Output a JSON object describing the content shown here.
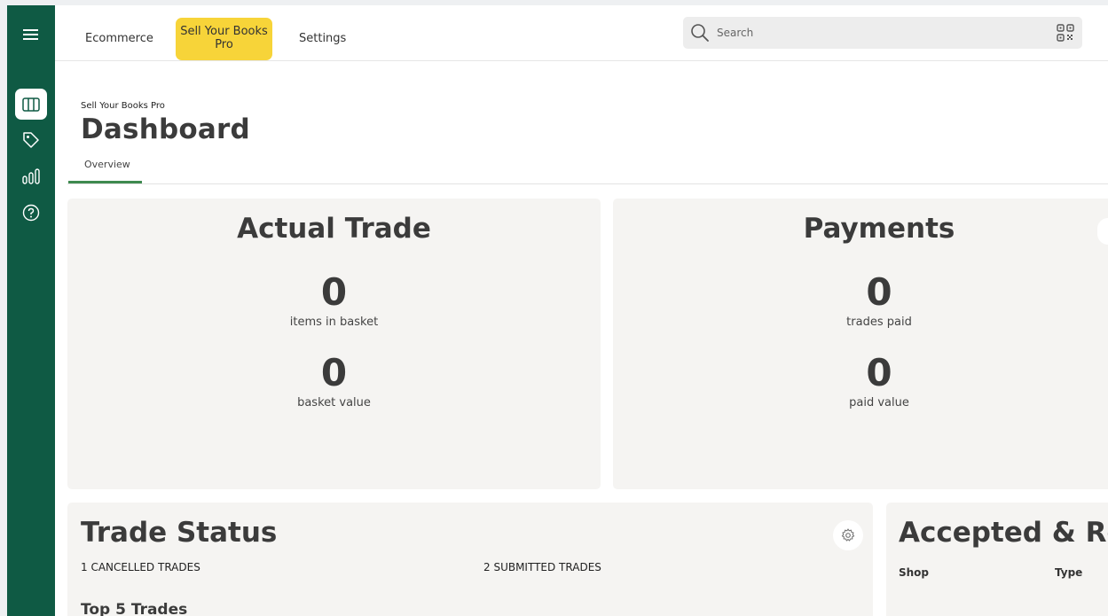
{
  "nav": {
    "tabs": [
      {
        "label": "Ecommerce"
      },
      {
        "label": "Sell Your Books Pro",
        "active": true
      },
      {
        "label": "Settings"
      }
    ]
  },
  "search": {
    "placeholder": "Search"
  },
  "rail": {
    "icons": [
      "menu-icon",
      "columns-icon",
      "tag-icon",
      "bar-chart-icon",
      "help-icon"
    ],
    "color": "#0f5a44"
  },
  "header": {
    "breadcrumb": "Sell Your Books Pro",
    "title": "Dashboard",
    "subtab": "Overview"
  },
  "actual_trade": {
    "title": "Actual Trade",
    "stats": [
      {
        "value": "0",
        "label": "items in basket"
      },
      {
        "value": "0",
        "label": "basket value"
      }
    ]
  },
  "payments": {
    "title": "Payments",
    "stats": [
      {
        "value": "0",
        "label": "trades paid"
      },
      {
        "value": "0",
        "label": "paid value"
      }
    ]
  },
  "trade_status": {
    "title": "Trade Status",
    "cancelled": "1 CANCELLED TRADES",
    "submitted": "2 SUBMITTED TRADES",
    "top5": "Top 5 Trades"
  },
  "accepted": {
    "title": "Accepted & Rejected",
    "columns": [
      "Shop",
      "Type"
    ]
  },
  "colors": {
    "accent": "#f7d439",
    "underline": "#3e8a4f"
  }
}
